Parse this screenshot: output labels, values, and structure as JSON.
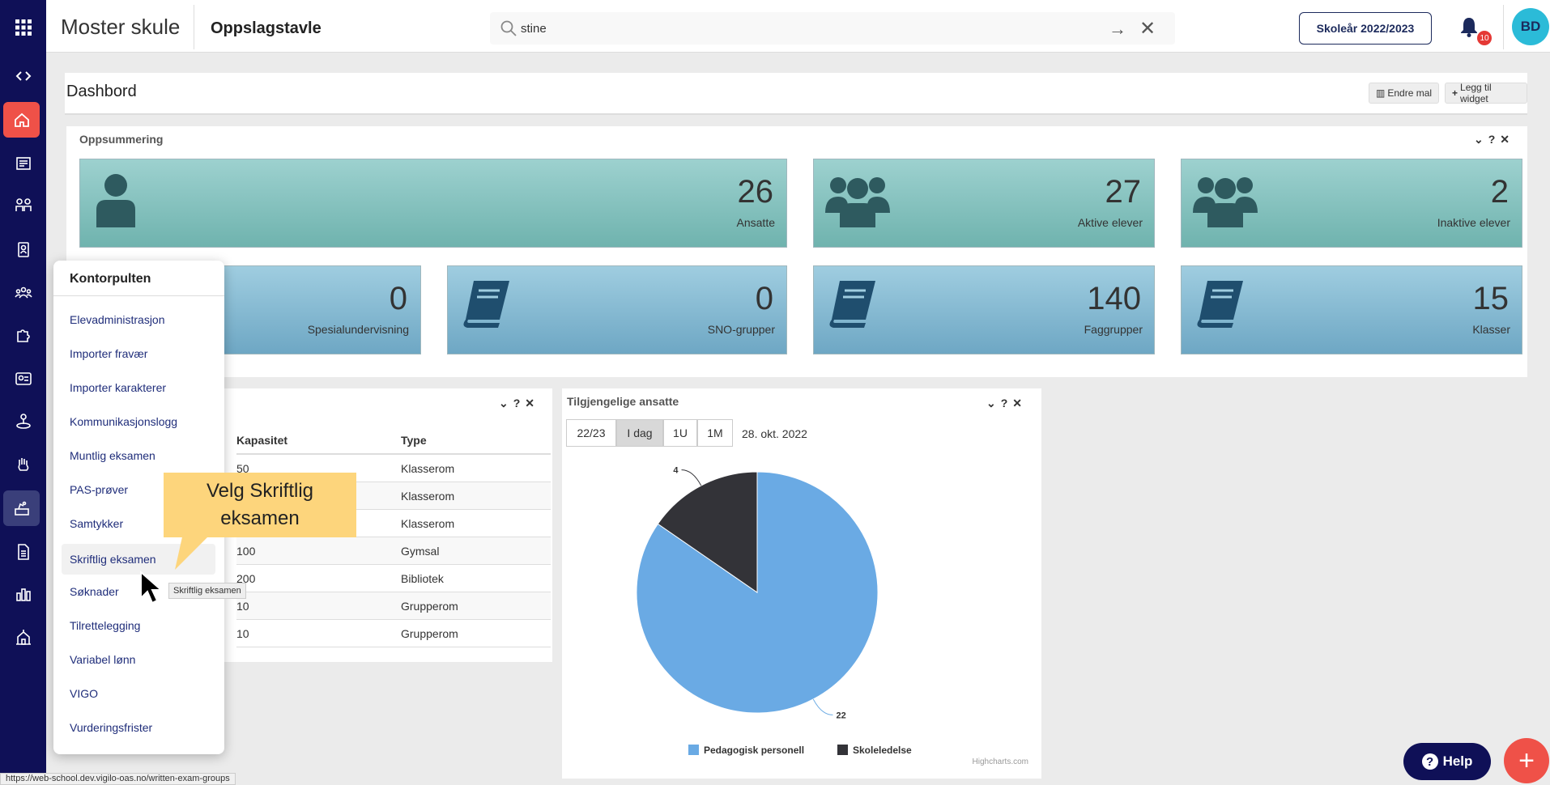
{
  "header": {
    "brand": "Moster skule",
    "breadcrumb": "Oppslagstavle",
    "search_value": "stine",
    "school_year": "Skoleår 2022/2023",
    "notification_count": "10",
    "user_initials": "BD"
  },
  "sidebar": {
    "icons": [
      "apps-grid-icon",
      "code-toggle-icon",
      "home-icon",
      "news-icon",
      "students-icon",
      "badge-icon",
      "groups-icon",
      "puzzle-icon",
      "exam-card-icon",
      "person-pin-icon",
      "hand-icon",
      "desk-icon",
      "document-icon",
      "bar-chart-icon",
      "school-icon"
    ]
  },
  "dashboard": {
    "title": "Dashbord",
    "edit_template": "Endre mal",
    "add_widget": "Legg til widget"
  },
  "summary": {
    "title": "Oppsummering",
    "tiles": [
      {
        "value": "26",
        "label": "Ansatte"
      },
      {
        "value": "27",
        "label": "Aktive elever"
      },
      {
        "value": "2",
        "label": "Inaktive elever"
      },
      {
        "value": "0",
        "label": "Spesialundervisning"
      },
      {
        "value": "0",
        "label": "SNO-grupper"
      },
      {
        "value": "140",
        "label": "Faggrupper"
      },
      {
        "value": "15",
        "label": "Klasser"
      }
    ]
  },
  "rooms": {
    "headers": [
      "Kapasitet",
      "Type"
    ],
    "rows": [
      [
        "50",
        "Klasserom"
      ],
      [
        "",
        "Klasserom"
      ],
      [
        "",
        "Klasserom"
      ],
      [
        "100",
        "Gymsal"
      ],
      [
        "200",
        "Bibliotek"
      ],
      [
        "10",
        "Grupperom"
      ],
      [
        "10",
        "Grupperom"
      ]
    ]
  },
  "staff": {
    "title": "Tilgjengelige ansatte",
    "periods": [
      "22/23",
      "I dag",
      "1U",
      "1M"
    ],
    "selected_period": "I dag",
    "date": "28. okt. 2022",
    "credits": "Highcharts.com"
  },
  "chart_data": {
    "type": "pie",
    "categories": [
      "Pedagogisk personell",
      "Skoleledelse"
    ],
    "values": [
      22,
      4
    ],
    "colors": [
      "#6aaae4",
      "#333338"
    ],
    "legend": "bottom"
  },
  "menu": {
    "title": "Kontorpulten",
    "items": [
      "Elevadministrasjon",
      "Importer fravær",
      "Importer karakterer",
      "Kommunikasjonslogg",
      "Muntlig eksamen",
      "PAS-prøver",
      "Samtykker",
      "Skriftlig eksamen",
      "Søknader",
      "Tilrettelegging",
      "Variabel lønn",
      "VIGO",
      "Vurderingsfrister"
    ],
    "highlighted": "Skriftlig eksamen"
  },
  "callout": {
    "line1": "Velg Skriftlig",
    "line2": "eksamen"
  },
  "tooltip": "Skriftlig eksamen",
  "status_url": "https://web-school.dev.vigilo-oas.no/written-exam-groups",
  "help_label": "Help"
}
